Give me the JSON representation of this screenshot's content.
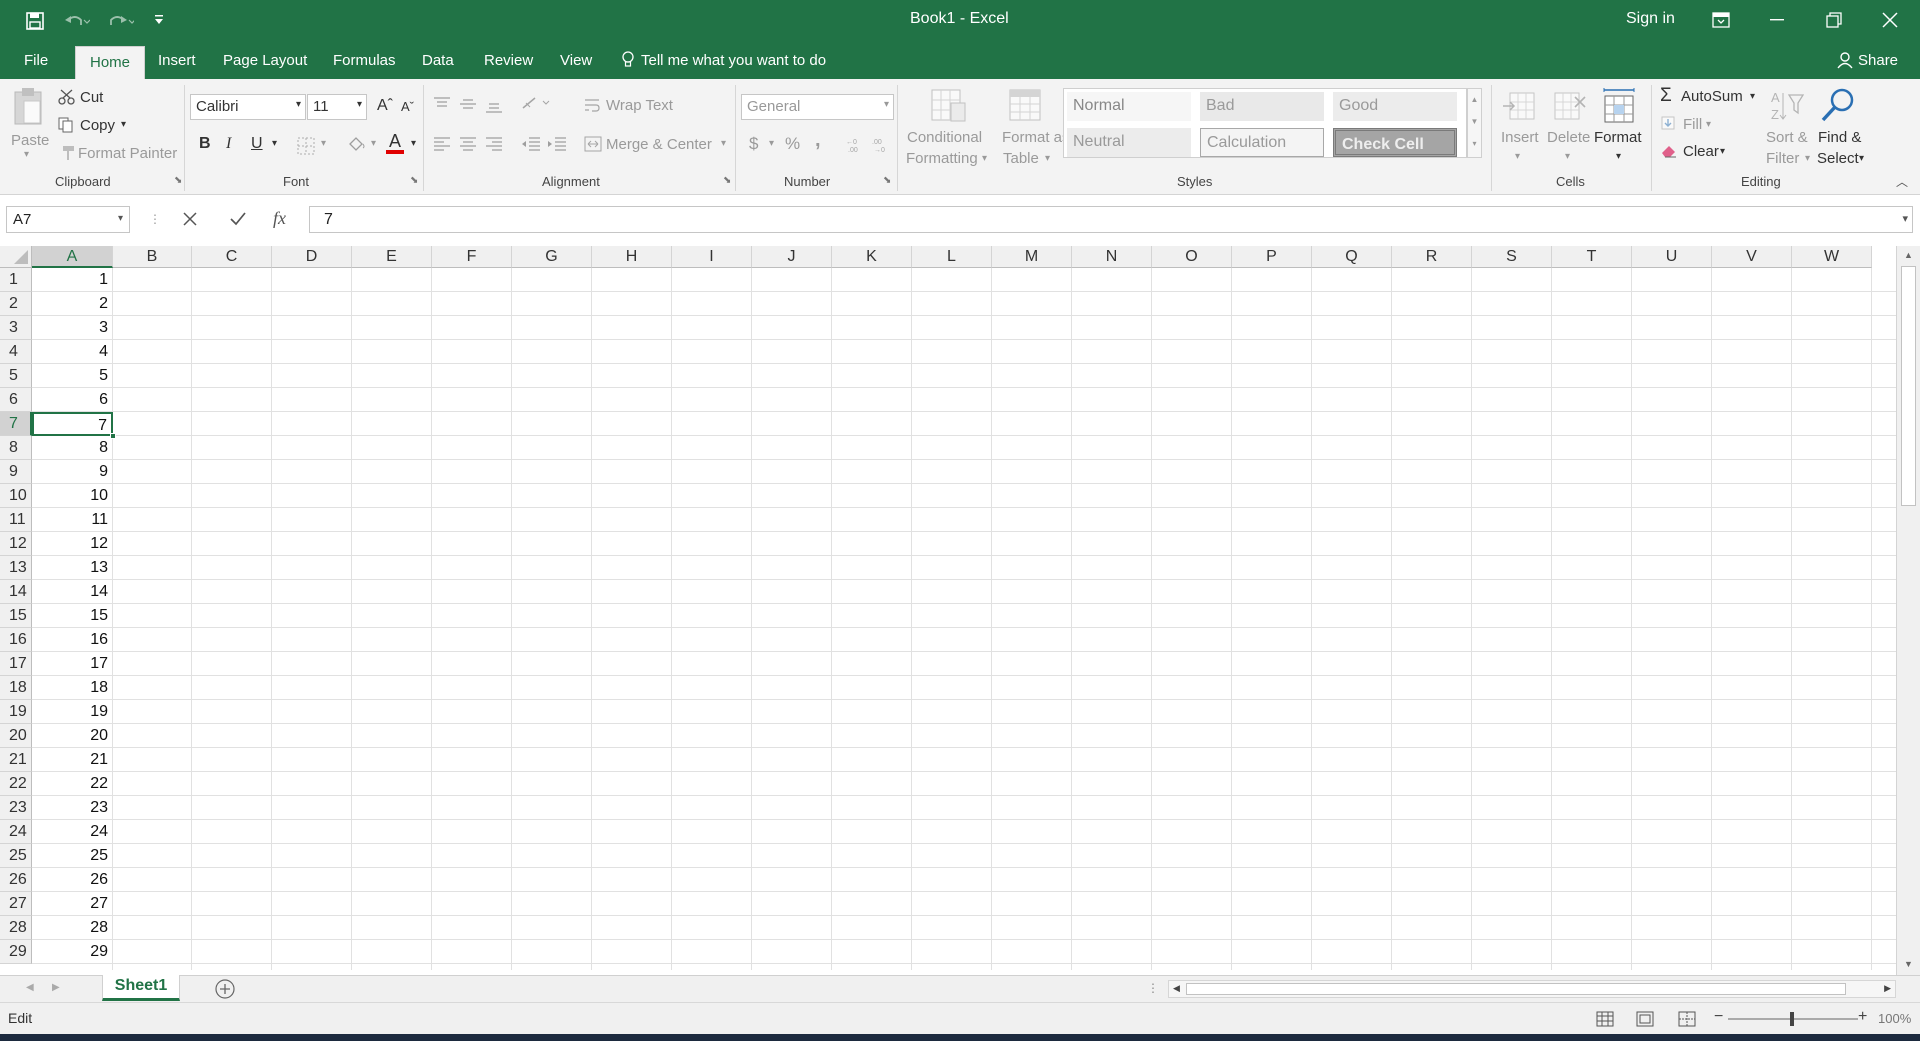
{
  "title": "Book1  -  Excel",
  "signin": "Sign in",
  "tabs": [
    "File",
    "Home",
    "Insert",
    "Page Layout",
    "Formulas",
    "Data",
    "Review",
    "View"
  ],
  "tellme": "Tell me what you want to do",
  "share": "Share",
  "clipboard": {
    "paste": "Paste",
    "cut": "Cut",
    "copy": "Copy",
    "format_painter": "Format Painter",
    "label": "Clipboard"
  },
  "font": {
    "name": "Calibri",
    "size": "11",
    "label": "Font",
    "bold": "B",
    "italic": "I",
    "underline": "U",
    "grow": "Aˆ",
    "shrink": "Aˇ",
    "color_letter": "A"
  },
  "alignment": {
    "wrap_text": "Wrap Text",
    "merge_center": "Merge & Center",
    "label": "Alignment"
  },
  "number": {
    "format": "General",
    "currency": "$",
    "percent": "%",
    "comma": ",",
    "label": "Number"
  },
  "styles": {
    "conditional": [
      "Conditional",
      "Formatting"
    ],
    "format_table": [
      "Format as",
      "Table"
    ],
    "cells": [
      "Normal",
      "Bad",
      "Good",
      "Neutral",
      "Calculation",
      "Check Cell"
    ],
    "label": "Styles"
  },
  "cells_group": {
    "insert": "Insert",
    "delete": "Delete",
    "format": "Format",
    "label": "Cells"
  },
  "editing": {
    "autosum": "AutoSum",
    "fill": "Fill",
    "clear": "Clear",
    "sort": [
      "Sort &",
      "Filter"
    ],
    "find": [
      "Find &",
      "Select"
    ],
    "label": "Editing"
  },
  "formula_bar": {
    "name_box": "A7",
    "fx": "fx",
    "value": "7"
  },
  "columns": [
    "A",
    "B",
    "C",
    "D",
    "E",
    "F",
    "G",
    "H",
    "I",
    "J",
    "K",
    "L",
    "M",
    "N",
    "O",
    "P",
    "Q",
    "R",
    "S",
    "T",
    "U",
    "V",
    "W"
  ],
  "rows": [
    "1",
    "2",
    "3",
    "4",
    "5",
    "6",
    "7",
    "8",
    "9",
    "10",
    "11",
    "12",
    "13",
    "14",
    "15",
    "16",
    "17",
    "18",
    "19",
    "20",
    "21",
    "22",
    "23",
    "24",
    "25",
    "26",
    "27",
    "28",
    "29"
  ],
  "col_a_values": [
    "1",
    "2",
    "3",
    "4",
    "5",
    "6",
    "7",
    "8",
    "9",
    "10",
    "11",
    "12",
    "13",
    "14",
    "15",
    "16",
    "17",
    "18",
    "19",
    "20",
    "21",
    "22",
    "23",
    "24",
    "25",
    "26",
    "27",
    "28",
    "29"
  ],
  "selected_cell": "A7",
  "sheet_tab": "Sheet1",
  "status": {
    "mode": "Edit",
    "zoom": "100%"
  },
  "colors": {
    "accent": "#217346",
    "selection": "#217346",
    "font_color": "#e00000"
  }
}
